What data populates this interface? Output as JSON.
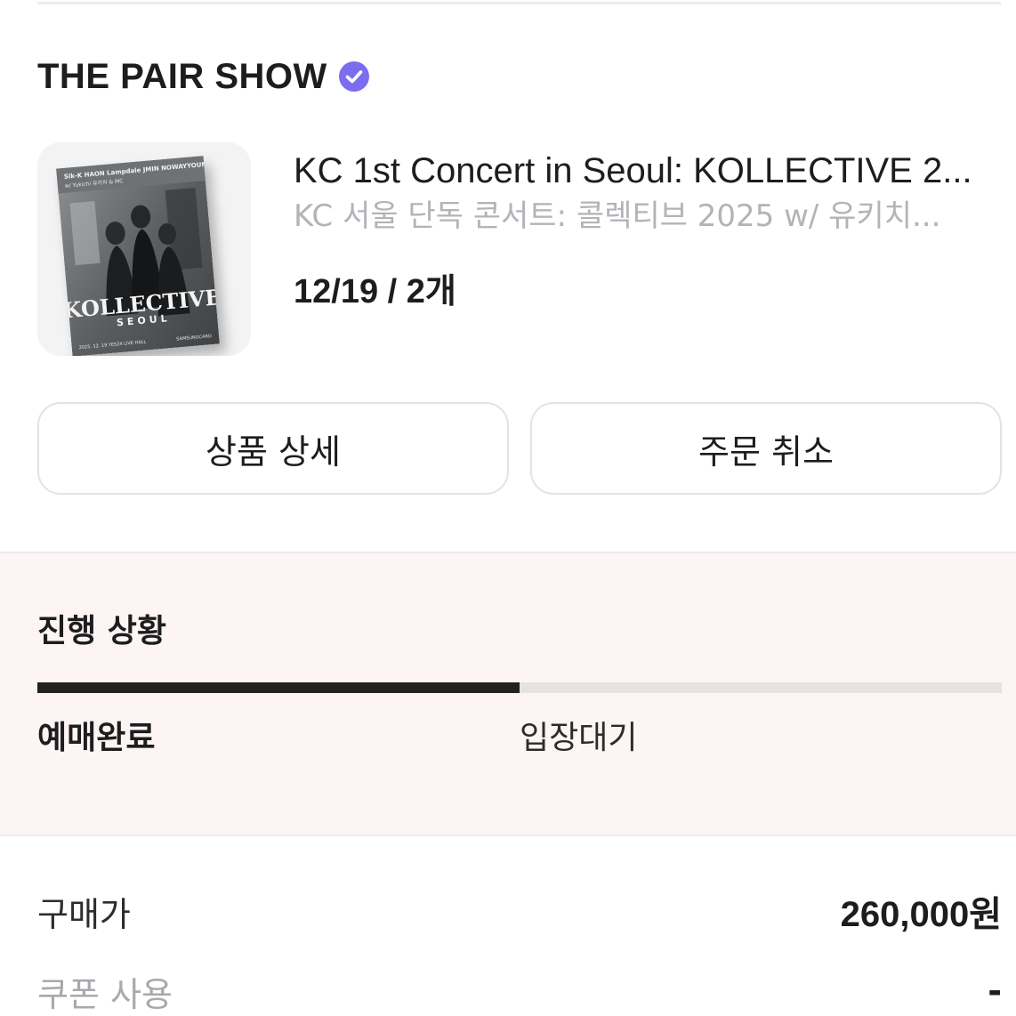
{
  "shop": {
    "name": "THE PAIR SHOW",
    "verified_icon": "verified-check-icon",
    "accent_color": "#7b6cf0"
  },
  "product": {
    "title": "KC 1st Concert in Seoul: KOLLECTIVE 2...",
    "subtitle": "KC 서울 단독 콘서트: 콜렉티브 2025 w/ 유키치...",
    "meta": "12/19 / 2개",
    "poster": {
      "logo_text": "KOLLECTIVE",
      "logo_sub": "SEOUL",
      "header_text": "Sik-K HAON Lampdale JMIN NOWAYYOUNG",
      "sub_header": "w/ Yukichi 유키치 & MC",
      "footer_left": "2025. 12. 19 YES24 LIVE HALL",
      "footer_right": "SAMSUNGCARD"
    }
  },
  "actions": {
    "detail_label": "상품 상세",
    "cancel_label": "주문 취소"
  },
  "progress": {
    "title": "진행 상황",
    "fill_fraction": 0.5,
    "steps": [
      "예매완료",
      "입장대기"
    ],
    "active_step": 0
  },
  "pricing": {
    "purchase_label": "구매가",
    "purchase_value": "260,000원",
    "coupon_label": "쿠폰 사용",
    "coupon_value": "-"
  }
}
